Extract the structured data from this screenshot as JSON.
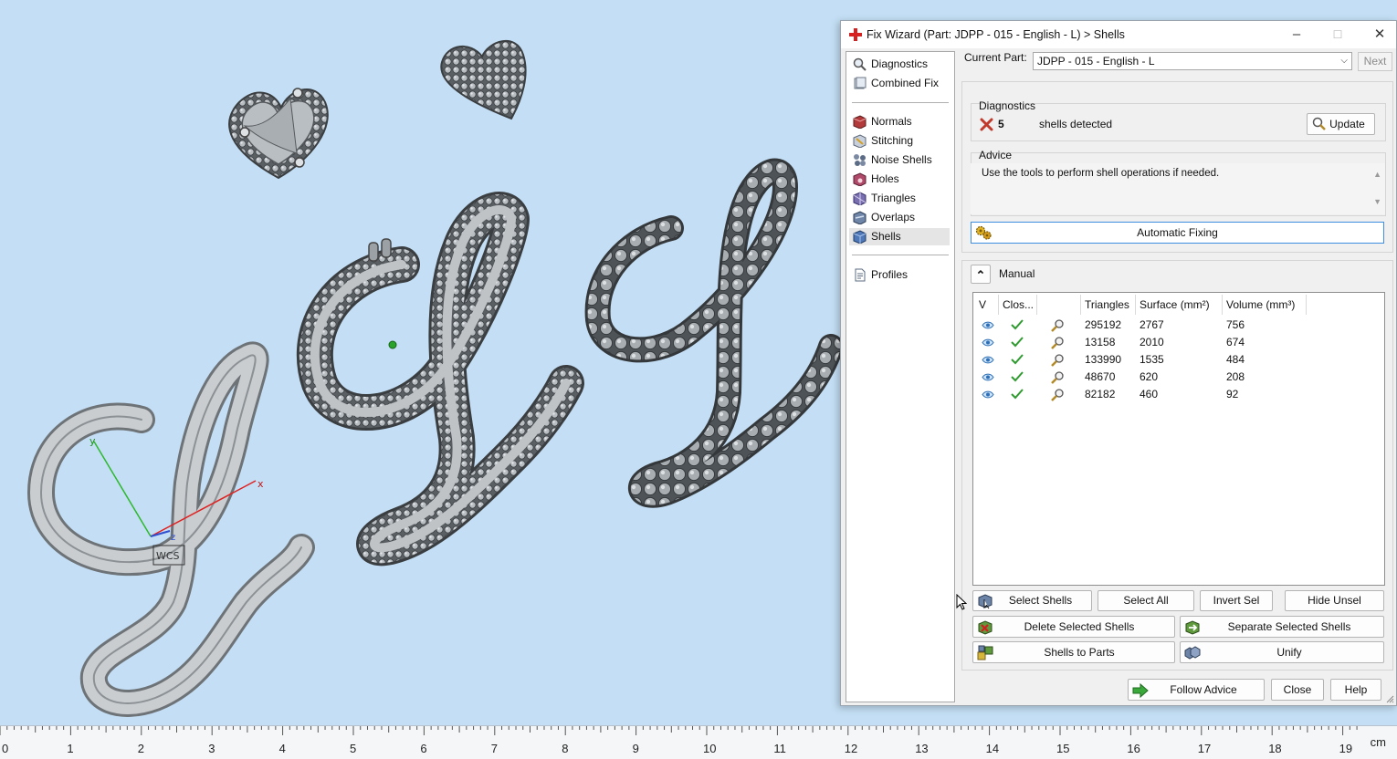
{
  "window": {
    "title": "Fix Wizard (Part: JDPP - 015 - English - L) > Shells",
    "minimize": "–",
    "maximize": "☐",
    "close": "✕"
  },
  "nav": {
    "items": [
      {
        "label": "Diagnostics",
        "icon": "diagnostics-icon"
      },
      {
        "label": "Combined Fix",
        "icon": "combined-fix-icon"
      },
      {
        "label": "Normals",
        "icon": "normals-icon"
      },
      {
        "label": "Stitching",
        "icon": "stitching-icon"
      },
      {
        "label": "Noise Shells",
        "icon": "noise-shells-icon"
      },
      {
        "label": "Holes",
        "icon": "holes-icon"
      },
      {
        "label": "Triangles",
        "icon": "triangles-icon"
      },
      {
        "label": "Overlaps",
        "icon": "overlaps-icon"
      },
      {
        "label": "Shells",
        "icon": "shells-icon",
        "selected": true
      },
      {
        "label": "Profiles",
        "icon": "profiles-icon"
      }
    ]
  },
  "current_part": {
    "label": "Current Part:",
    "value": "JDPP - 015 - English - L",
    "next": "Next"
  },
  "diagnostics": {
    "title": "Diagnostics",
    "count": "5",
    "text": "shells detected",
    "update": "Update",
    "status_color": "#c0392b"
  },
  "advice": {
    "title": "Advice",
    "text": "Use the tools to perform shell operations if needed."
  },
  "automatic_fixing": "Automatic Fixing",
  "manual": {
    "title": "Manual",
    "collapse": "⌃"
  },
  "table": {
    "headers": {
      "v": "V",
      "closed": "Clos...",
      "tools": "",
      "triangles": "Triangles",
      "surface": "Surface (mm²)",
      "volume": "Volume (mm³)"
    },
    "rows": [
      {
        "triangles": "295192",
        "surface": "2767",
        "volume": "756"
      },
      {
        "triangles": "13158",
        "surface": "2010",
        "volume": "674"
      },
      {
        "triangles": "133990",
        "surface": "1535",
        "volume": "484"
      },
      {
        "triangles": "48670",
        "surface": "620",
        "volume": "208"
      },
      {
        "triangles": "82182",
        "surface": "460",
        "volume": "92"
      }
    ]
  },
  "buttons": {
    "select_shells": "Select Shells",
    "select_all": "Select All",
    "invert_sel": "Invert Sel",
    "hide_unsel": "Hide Unsel",
    "delete_selected": "Delete Selected Shells",
    "separate_selected": "Separate Selected Shells",
    "shells_to_parts": "Shells to Parts",
    "unify": "Unify",
    "follow_advice": "Follow Advice",
    "close": "Close",
    "help": "Help"
  },
  "viewport": {
    "axis_x": "x",
    "axis_y": "y",
    "axis_z": "z",
    "wcs": "WCS"
  },
  "ruler": {
    "unit": "cm",
    "labels": [
      "0",
      "1",
      "2",
      "3",
      "4",
      "5",
      "6",
      "7",
      "8",
      "9",
      "10",
      "11",
      "12",
      "13",
      "14",
      "15",
      "16",
      "17",
      "18",
      "19"
    ]
  },
  "colors": {
    "viewport_bg": "#c4dff5",
    "accent": "#3d8ee0",
    "ok_green": "#2f9a2f"
  }
}
